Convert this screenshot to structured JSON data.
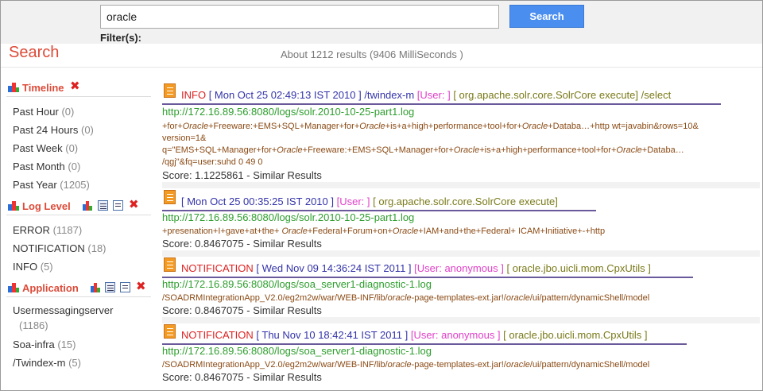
{
  "search": {
    "query": "oracle",
    "button_label": "Search",
    "filters_label": "Filter(s):"
  },
  "page": {
    "title": "Search",
    "stats": "About 1212 results (9406 MilliSeconds )"
  },
  "sidebar": {
    "timeline": {
      "title": "Timeline",
      "items": [
        {
          "label": "Past Hour",
          "count": "(0)"
        },
        {
          "label": "Past 24 Hours",
          "count": "(0)"
        },
        {
          "label": "Past Week",
          "count": "(0)"
        },
        {
          "label": "Past Month",
          "count": "(0)"
        },
        {
          "label": "Past Year",
          "count": "(1205)"
        }
      ]
    },
    "log_level": {
      "title": "Log Level",
      "items": [
        {
          "label": "ERROR",
          "count": "(1187)"
        },
        {
          "label": "NOTIFICATION",
          "count": "(18)"
        },
        {
          "label": "INFO",
          "count": "(5)"
        }
      ]
    },
    "application": {
      "title": "Application",
      "items": [
        {
          "label": "Usermessagingserver",
          "count": "(1186)"
        },
        {
          "label": "Soa-infra",
          "count": "(15)"
        },
        {
          "label": "/Twindex-m",
          "count": "(5)"
        }
      ]
    }
  },
  "results": [
    {
      "level": "INFO",
      "timestamp": "[ Mon Oct 25 02:49:13 IST 2010 ]",
      "source": "/twindex-m",
      "user": "[User: ]",
      "class": "[ org.apache.solr.core.SolrCore execute]",
      "path": "/select",
      "url": "http://172.16.89.56:8080/logs/solr.2010-10-25-part1.log",
      "snippet_1": "+for+Oracle+Freeware:+EMS+SQL+Manager+for+Oracle+is+a+high+performance+tool+for+Oracle+Databa…+http wt=javabin&rows=10&",
      "snippet_2": "version=1&",
      "snippet_3": "q=\"EMS+SQL+Manager+for+Oracle+Freeware:+EMS+SQL+Manager+for+Oracle+is+a+high+performance+tool+for+Oracle+Databa…",
      "snippet_4": "/qgj\"&fq=user:suhd 0 49 0",
      "score": "Score: 1.1225861",
      "similar": "Similar Results"
    },
    {
      "level": "",
      "timestamp": "[ Mon Oct 25 00:35:25 IST 2010 ]",
      "source": "",
      "user": "[User: ]",
      "class": "[ org.apache.solr.core.SolrCore execute]",
      "path": "",
      "url": "http://172.16.89.56:8080/logs/solr.2010-10-25-part1.log",
      "snippet_1": "+presenation+I+gave+at+the+ Oracle+Federal+Forum+on+Oracle+IAM+and+the+Federal+ ICAM+Initiative+-+http",
      "score": "Score: 0.8467075",
      "similar": "Similar Results"
    },
    {
      "level": "NOTIFICATION",
      "timestamp": "[ Wed Nov 09 14:36:24 IST 2011 ]",
      "source": "",
      "user": "[User: anonymous ]",
      "class": "[ oracle.jbo.uicli.mom.CpxUtils ]",
      "path": "",
      "url": "http://172.16.89.56:8080/logs/soa_server1-diagnostic-1.log",
      "snippet_1": "/SOADRMIntegrationApp_V2.0/eg2m2w/war/WEB-INF/lib/oracle-page-templates-ext.jar!/oracle/ui/pattern/dynamicShell/model",
      "score": "Score: 0.8467075",
      "similar": "Similar Results"
    },
    {
      "level": "NOTIFICATION",
      "timestamp": "[ Thu Nov 10 18:42:41 IST 2011 ]",
      "source": "",
      "user": "[User: anonymous ]",
      "class": "[ oracle.jbo.uicli.mom.CpxUtils ]",
      "path": "",
      "url": "http://172.16.89.56:8080/logs/soa_server1-diagnostic-1.log",
      "snippet_1": "/SOADRMIntegrationApp_V2.0/eg2m2w/war/WEB-INF/lib/oracle-page-templates-ext.jar!/oracle/ui/pattern/dynamicShell/model",
      "score": "Score: 0.8467075",
      "similar": "Similar Results"
    }
  ],
  "colors": {
    "accent": "#dd4b39",
    "button": "#4a8ef0",
    "url": "#2e9e2e",
    "user": "#e040c8"
  }
}
